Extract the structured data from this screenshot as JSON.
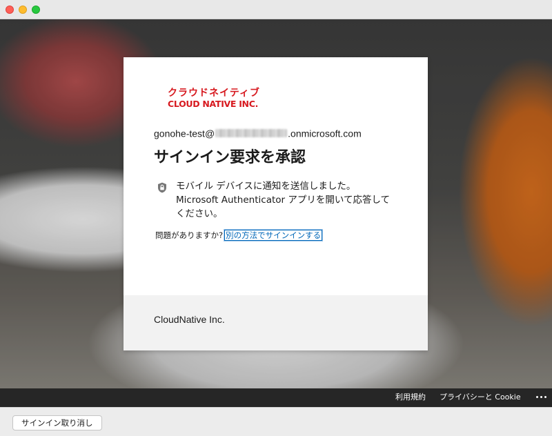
{
  "window": {
    "buttons": [
      "close",
      "minimize",
      "maximize"
    ]
  },
  "logo": {
    "line1": "クラウドネイティブ",
    "line2": "CLOUD NATIVE INC.",
    "color": "#d7191f"
  },
  "signin": {
    "email_prefix": "gonohe-test@",
    "email_suffix": ".onmicrosoft.com",
    "title": "サインイン要求を承認",
    "lock_icon": "lock-icon",
    "message_lines": [
      "モバイル デバイスに通知を送信しました。",
      "Microsoft Authenticator アプリを開いて応答して",
      "ください。"
    ],
    "trouble_text": "問題がありますか?",
    "trouble_link": "別の方法でサインインする",
    "link_color": "#0067b8"
  },
  "card_footer": {
    "company": "CloudNative Inc."
  },
  "footer": {
    "terms": "利用規約",
    "privacy": "プライバシーと Cookie",
    "more_icon": "more-dots-icon"
  },
  "cancel": {
    "label": "サインイン取り消し"
  }
}
